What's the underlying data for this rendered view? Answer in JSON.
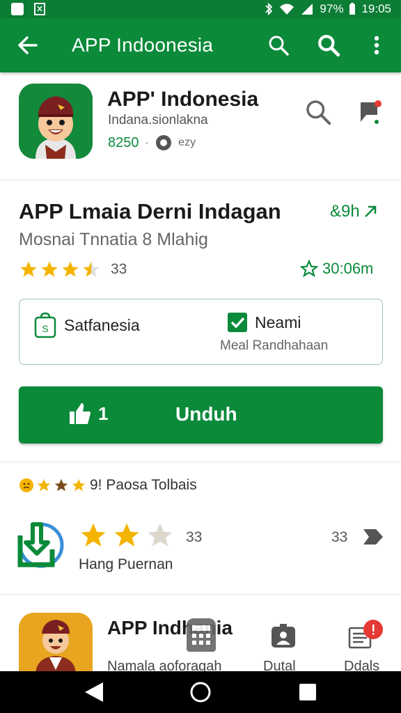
{
  "status_bar": {
    "battery": "97%",
    "time": "19:05"
  },
  "app_bar": {
    "title": "APP Indoonesia"
  },
  "header_app": {
    "name": "APP' Indonesia",
    "subtitle": "Indana.sionlakna",
    "price": "8250",
    "meta_small": "ezy"
  },
  "detail": {
    "title": "APP Lmaia Derni Indagan",
    "subtitle": "Mosnai Tnnatia 8 Mlahig",
    "rating_count": "33",
    "top_right_label": "&9h",
    "right_label": "30:06m"
  },
  "info_box": {
    "left_label": "Satfanesia",
    "right_label": "Neami",
    "right_sub": "Meal Randhahaan"
  },
  "download_button": {
    "count": "1",
    "label": "Unduh"
  },
  "reviews_section": {
    "header_label": "9! Paosa Tolbais",
    "review_count_left": "33",
    "review_count_right": "33",
    "reviewer": "Hang Puernan"
  },
  "bottom_card": {
    "name": "APP Indhania",
    "subtitle": "Namala aoforagah",
    "tab_1": "Dutal",
    "tab_2": "Ddals"
  },
  "colors": {
    "primary": "#0b8a3a",
    "status": "#0b7d35",
    "star": "#f4b400"
  }
}
